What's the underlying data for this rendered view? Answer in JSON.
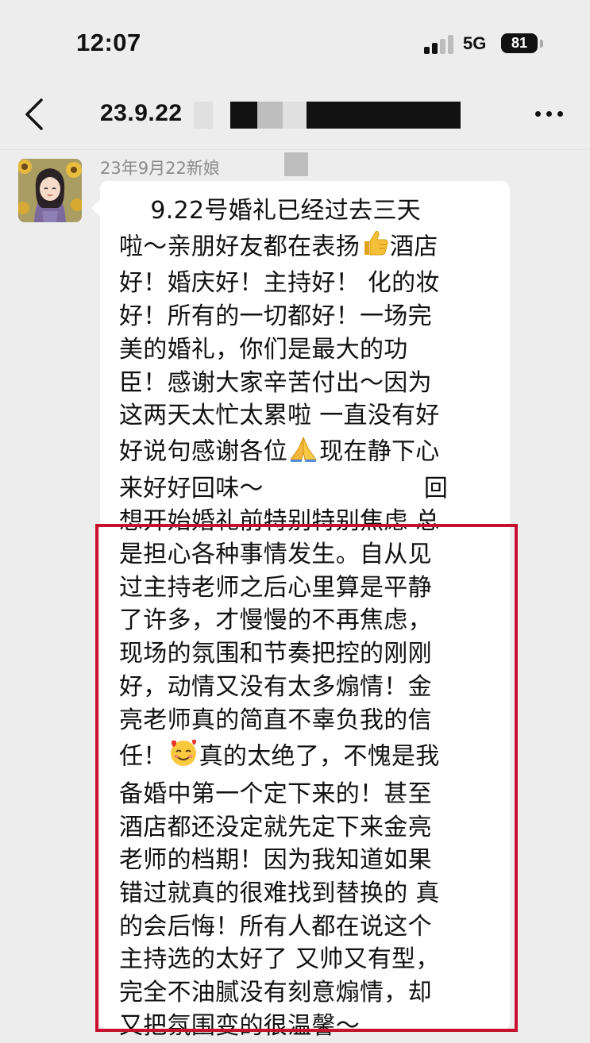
{
  "status_bar": {
    "time": "12:07",
    "network": "5G",
    "battery": "81"
  },
  "nav": {
    "title": "23.9.22",
    "back_icon": "chevron-left-icon",
    "more_icon": "more-dots-icon"
  },
  "message": {
    "sender_label": "23年9月22新娘",
    "lines": [
      "    9.22号婚礼已经过去三天",
      "啦～亲朋好友都在表扬",
      "酒店",
      "好！婚庆好！主持好！ 化的妆",
      "好！所有的一切都好！一场完",
      "美的婚礼，你们是最大的功",
      "臣！感谢大家辛苦付出～因为",
      "这两天太忙太累啦 一直没有好",
      "好说句感谢各位",
      "现在静下心",
      "来好好回味～",
      "回",
      "想开始婚礼前特别特别焦虑 总",
      "是担心各种事情发生。自从见",
      "过主持老师之后心里算是平静",
      "了许多，才慢慢的不再焦虑，",
      "现场的氛围和节奏把控的刚刚",
      "好，动情又没有太多煽情！金",
      "亮老师真的简直不辜负我的信",
      "任！",
      "真的太绝了，不愧是我",
      "备婚中第一个定下来的！甚至",
      "酒店都还没定就先定下来金亮",
      "老师的档期！因为我知道如果",
      "错过就真的很难找到替换的 真",
      "的会后悔！所有人都在说这个",
      "主持选的太好了 又帅又有型，",
      "完全不油腻没有刻意煽情，却",
      "又把氛围变的很温馨～"
    ],
    "emoji_names": [
      "thumbs-up-emoji",
      "folded-hands-emoji",
      "smiling-face-with-hearts-emoji"
    ]
  },
  "colors": {
    "background": "#ededed",
    "bubble": "#ffffff",
    "highlight_border": "#c8102e"
  }
}
